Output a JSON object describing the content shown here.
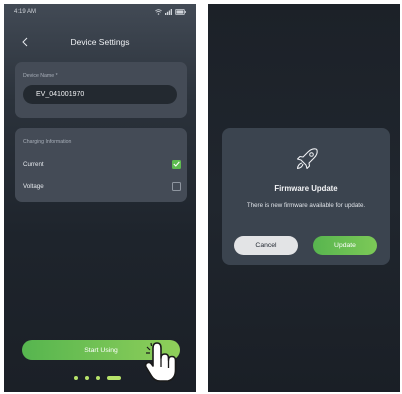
{
  "status_bar": {
    "time": "4:19 AM"
  },
  "header": {
    "title": "Device Settings"
  },
  "device_card": {
    "label": "Device Name *",
    "value": "EV_041001970"
  },
  "charging_card": {
    "title": "Charging Information",
    "options": [
      {
        "label": "Current",
        "checked": true
      },
      {
        "label": "Voltage",
        "checked": false
      }
    ]
  },
  "start_button": {
    "label": "Start Using"
  },
  "pager": {
    "count": 4,
    "active_index": 3
  },
  "dialog": {
    "title": "Firmware Update",
    "message": "There is new firmware available for update.",
    "cancel_label": "Cancel",
    "update_label": "Update"
  },
  "colors": {
    "accent_green": "#5dbb4f",
    "card_bg": "#444b56",
    "dialog_bg": "#3b444f"
  }
}
